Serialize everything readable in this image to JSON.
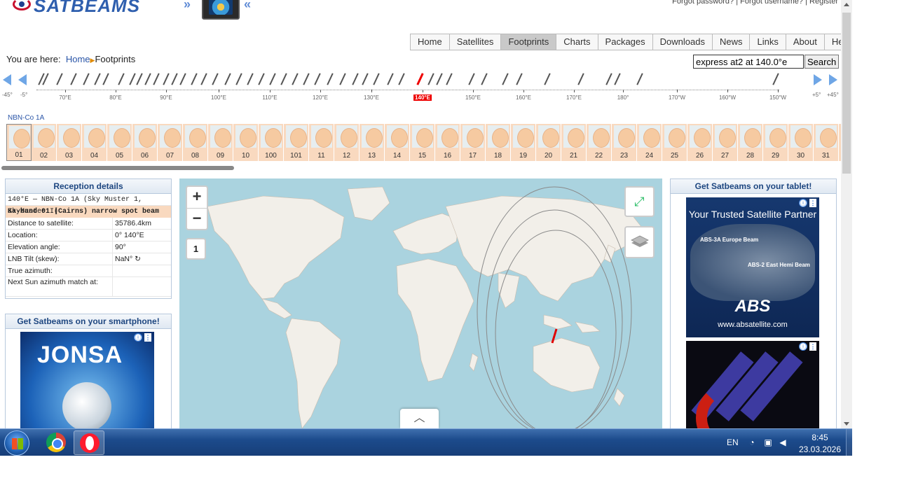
{
  "header": {
    "logo_text": "SATBEAMS",
    "top_links": [
      "Forgot password?",
      "Forgot username?",
      "Register"
    ]
  },
  "nav": {
    "items": [
      "Home",
      "Satellites",
      "Footprints",
      "Charts",
      "Packages",
      "Downloads",
      "News",
      "Links",
      "About",
      "Help"
    ],
    "active": "Footprints"
  },
  "breadcrumb": {
    "label": "You are here:",
    "home": "Home",
    "current": "Footprints"
  },
  "search": {
    "value": "express at2 at 140.0°e",
    "button": "Search"
  },
  "orbit_scale": {
    "left_edge_labels": [
      "-45°",
      "-5°"
    ],
    "right_edge_labels": [
      "+5°",
      "+45°"
    ],
    "degree_labels": [
      "70°E",
      "80°E",
      "90°E",
      "100°E",
      "110°E",
      "120°E",
      "130°E",
      "140°E",
      "150°E",
      "160°E",
      "170°E",
      "180°",
      "170°W",
      "160°W",
      "150°W"
    ],
    "selected": "140°E",
    "accent": "#e00000"
  },
  "beams": {
    "satellite_label": "NBN-Co 1A",
    "numbers": [
      "01",
      "02",
      "03",
      "04",
      "05",
      "06",
      "07",
      "08",
      "09",
      "10",
      "100",
      "101",
      "11",
      "12",
      "13",
      "14",
      "15",
      "16",
      "17",
      "18",
      "19",
      "20",
      "21",
      "22",
      "23",
      "24",
      "25",
      "26",
      "27",
      "28",
      "29",
      "30",
      "31"
    ],
    "selected": "01"
  },
  "reception": {
    "title": "Reception details",
    "satellite": "140°E — NBN-Co 1A (Sky Muster 1, SkyMuster I)",
    "beam": "Ka-band 01 (Cairns) narrow spot beam",
    "rows": [
      {
        "key": "Distance to satellite:",
        "value": "35786.4km"
      },
      {
        "key": "Location:",
        "value": "0° 140°E"
      },
      {
        "key": "Elevation angle:",
        "value": "90°"
      },
      {
        "key": "LNB Tilt (skew):",
        "value": "NaN° ↻"
      },
      {
        "key": "True azimuth:",
        "value": ""
      },
      {
        "key": "Next Sun azimuth match at:",
        "value": ""
      }
    ]
  },
  "ads": {
    "smartphone_title": "Get Satbeams on your smartphone!",
    "tablet_title": "Get Satbeams on your tablet!",
    "jonsa_brand": "JONSA",
    "abs_tagline": "Your Trusted Satellite Partner",
    "abs_beam1": "ABS-3A Europe Beam",
    "abs_beam2": "ABS-2 East Hemi Beam",
    "abs_logo": "ABS",
    "abs_url": "www.absatellite.com",
    "info_glyph": "ⓘ",
    "menu_glyph": "⋮"
  },
  "map": {
    "zoom_in": "+",
    "zoom_out": "−",
    "beam_number": "1",
    "fullscreen_icon": "expand-icon",
    "layers_icon": "layers-icon",
    "collapse_glyph": "^",
    "water_color": "#aad3df",
    "land_color": "#f2efe9"
  },
  "taskbar": {
    "language": "EN",
    "time": "8:45",
    "date": "23.03.2026"
  }
}
